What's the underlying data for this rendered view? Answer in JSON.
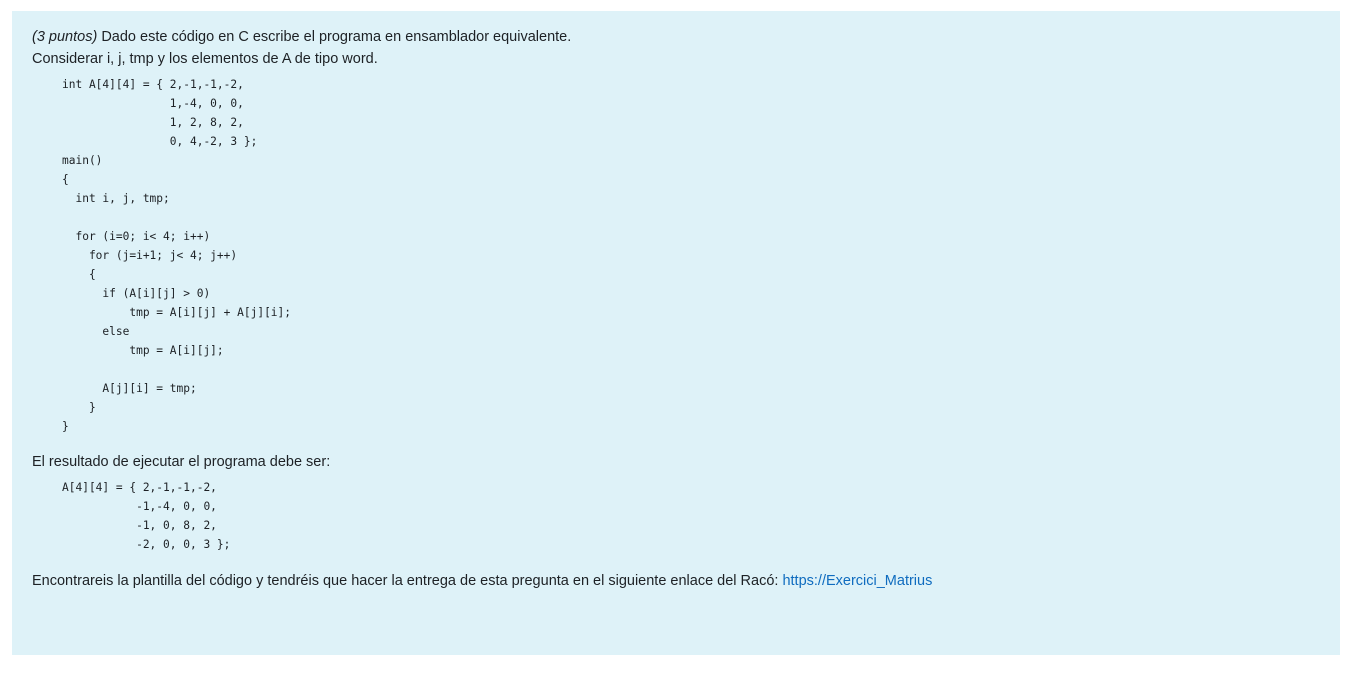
{
  "question": {
    "points_label": "(3 puntos)",
    "intro_rest": " Dado este código en C escribe el programa en ensamblador equivalente.",
    "consider_line": "Considerar i, j, tmp y los elementos de A de tipo word.",
    "c_code": "int A[4][4] = { 2,-1,-1,-2,\n                1,-4, 0, 0,\n                1, 2, 8, 2,\n                0, 4,-2, 3 };\nmain()\n{\n  int i, j, tmp;\n\n  for (i=0; i< 4; i++)\n    for (j=i+1; j< 4; j++)\n    {\n      if (A[i][j] > 0)\n          tmp = A[i][j] + A[j][i];\n      else\n          tmp = A[i][j];\n\n      A[j][i] = tmp;\n    }\n}",
    "result_intro": "El resultado de ejecutar el programa debe ser:",
    "result_code": "A[4][4] = { 2,-1,-1,-2,\n           -1,-4, 0, 0,\n           -1, 0, 8, 2,\n           -2, 0, 0, 3 };",
    "final_text": "Encontrareis la plantilla del código y tendréis que hacer la entrega de esta pregunta en el siguiente enlace del Racó: ",
    "link_text": "https://Exercici_Matrius"
  },
  "colors": {
    "background": "#def2f8",
    "text": "#1d2125",
    "link": "#0f6cbf"
  }
}
